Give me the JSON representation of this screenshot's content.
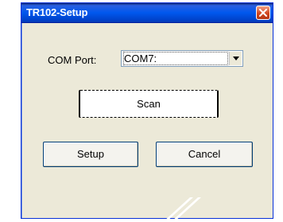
{
  "window": {
    "title": "TR102-Setup"
  },
  "form": {
    "com_port_label": "COM Port:",
    "com_port_value": "COM7:"
  },
  "buttons": {
    "scan_label": "Scan",
    "setup_label": "Setup",
    "cancel_label": "Cancel"
  },
  "icons": {
    "close": "close-icon",
    "dropdown": "chevron-down-icon"
  },
  "colors": {
    "titlebar": "#0058ee",
    "close_button": "#d2451e",
    "dialog_background": "#ece9d8"
  }
}
